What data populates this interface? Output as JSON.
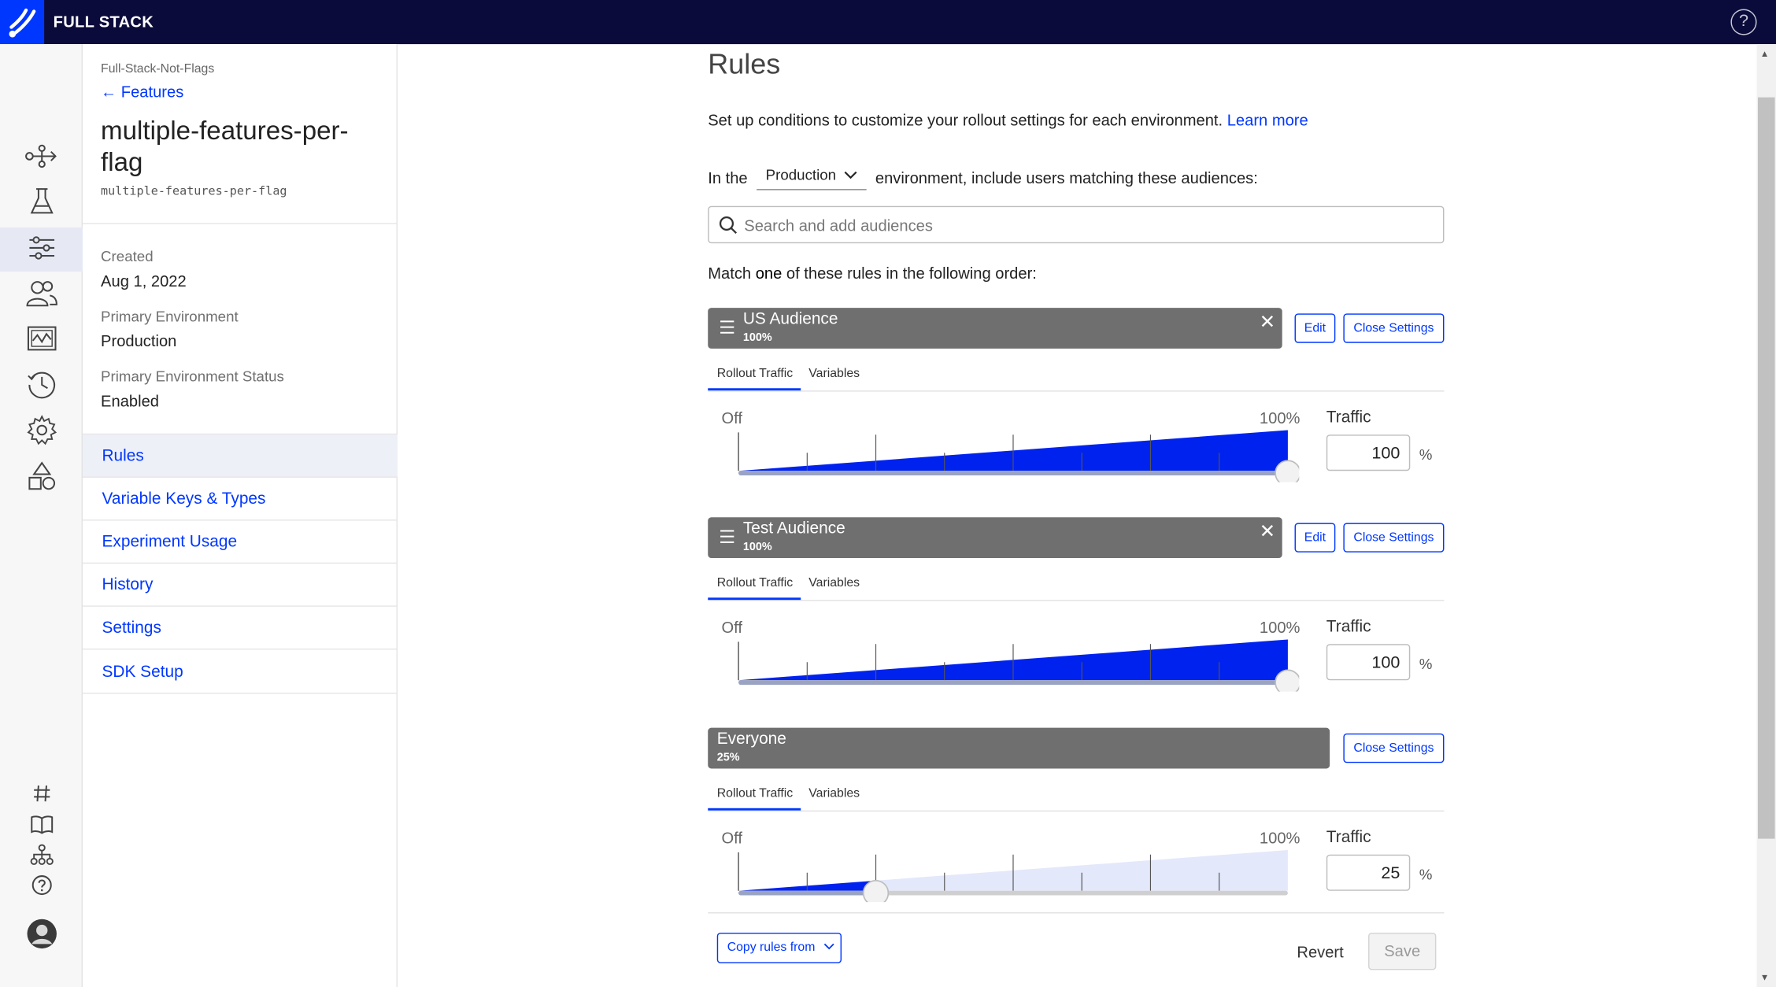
{
  "app": {
    "brand": "FULL STACK"
  },
  "nav_icons": [
    "flags-icon",
    "experiments-icon",
    "features-icon",
    "audiences-icon",
    "reports-icon",
    "history-icon",
    "settings-icon",
    "components-icon",
    "hash-icon",
    "docs-icon",
    "hierarchy-icon",
    "help-icon",
    "avatar-icon"
  ],
  "sidebar": {
    "breadcrumb": "Full-Stack-Not-Flags",
    "back_label": "Features",
    "flag_title": "multiple-features-per-flag",
    "flag_key": "multiple-features-per-flag",
    "created_label": "Created",
    "created_value": "Aug 1, 2022",
    "primary_env_label": "Primary Environment",
    "primary_env_value": "Production",
    "primary_env_status_label": "Primary Environment Status",
    "primary_env_status_value": "Enabled",
    "menu": [
      "Rules",
      "Variable Keys & Types",
      "Experiment Usage",
      "History",
      "Settings",
      "SDK Setup"
    ],
    "active_menu": "Rules"
  },
  "main": {
    "heading": "Rules",
    "intro_text": "Set up conditions to customize your rollout settings for each environment.",
    "learn_more": "Learn more",
    "env_prefix": "In the",
    "env_value": "Production",
    "env_suffix": "environment, include users matching these audiences:",
    "search_placeholder": "Search and add audiences",
    "match_prefix": "Match",
    "match_emph": "one",
    "match_suffix": "of these rules in the following order:",
    "rules": [
      {
        "name": "US Audience",
        "percent_label": "100%",
        "traffic": "100",
        "fraction": 1.0,
        "removable": true,
        "edit_label": "Edit",
        "close_label": "Close Settings",
        "tab_rollout": "Rollout Traffic",
        "tab_variables": "Variables",
        "off_label": "Off",
        "max_label": "100%",
        "traffic_label": "Traffic",
        "pct_suffix": "%"
      },
      {
        "name": "Test Audience",
        "percent_label": "100%",
        "traffic": "100",
        "fraction": 1.0,
        "removable": true,
        "edit_label": "Edit",
        "close_label": "Close Settings",
        "tab_rollout": "Rollout Traffic",
        "tab_variables": "Variables",
        "off_label": "Off",
        "max_label": "100%",
        "traffic_label": "Traffic",
        "pct_suffix": "%"
      },
      {
        "name": "Everyone",
        "percent_label": "25%",
        "traffic": "25",
        "fraction": 0.25,
        "removable": false,
        "edit_label": "",
        "close_label": "Close Settings",
        "tab_rollout": "Rollout Traffic",
        "tab_variables": "Variables",
        "off_label": "Off",
        "max_label": "100%",
        "traffic_label": "Traffic",
        "pct_suffix": "%"
      }
    ],
    "copy_rules_label": "Copy rules from",
    "revert_label": "Revert",
    "save_label": "Save"
  },
  "colors": {
    "topbar": "#0b0b3b",
    "accent": "#0037ff",
    "rule_bar": "#6f6f6f",
    "fill": "#0022ee",
    "fill_light": "#e3e8fb"
  }
}
